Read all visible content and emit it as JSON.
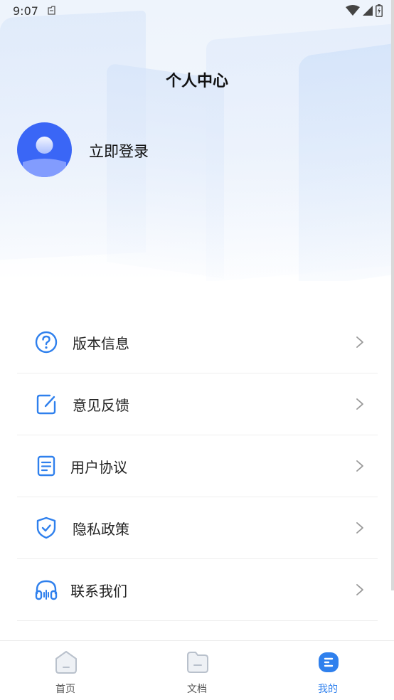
{
  "status_bar": {
    "time": "9:07"
  },
  "header": {
    "title": "个人中心"
  },
  "profile": {
    "login_label": "立即登录"
  },
  "menu": {
    "items": [
      {
        "label": "版本信息",
        "icon": "question-circle-icon"
      },
      {
        "label": "意见反馈",
        "icon": "edit-note-icon"
      },
      {
        "label": "用户协议",
        "icon": "document-icon"
      },
      {
        "label": "隐私政策",
        "icon": "shield-check-icon"
      },
      {
        "label": "联系我们",
        "icon": "headset-icon"
      }
    ]
  },
  "tab_bar": {
    "tabs": [
      {
        "label": "首页",
        "icon": "home-icon",
        "active": false
      },
      {
        "label": "文档",
        "icon": "folder-icon",
        "active": false
      },
      {
        "label": "我的",
        "icon": "profile-icon",
        "active": true
      }
    ]
  },
  "colors": {
    "accent": "#2f80ed",
    "avatar_bg": "#3a66f6",
    "inactive_tab": "#b9c1cc"
  }
}
